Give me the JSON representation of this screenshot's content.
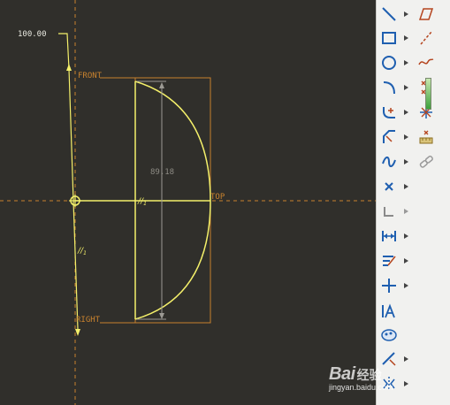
{
  "sketch": {
    "dimension_value": "100.00",
    "diameter_value": "89.18",
    "reference_labels": {
      "front": "FRONT",
      "top": "TOP",
      "right": "RIGHT"
    },
    "parallel_constraint_symbol": "//",
    "constraint_index": "1"
  },
  "toolbar": {
    "tools": [
      {
        "name": "line-tool",
        "icon": "line-icon"
      },
      {
        "name": "rectangle-tool",
        "icon": "rectangle-icon"
      },
      {
        "name": "circle-tool",
        "icon": "circle-icon"
      },
      {
        "name": "arc-tool",
        "icon": "arc-icon"
      },
      {
        "name": "fillet-tool",
        "icon": "fillet-icon"
      },
      {
        "name": "chamfer-tool",
        "icon": "chamfer-icon"
      },
      {
        "name": "spline-tool",
        "icon": "spline-icon"
      },
      {
        "name": "point-tool",
        "icon": "point-icon"
      },
      {
        "name": "coordinate-system-tool",
        "icon": "coordinate-system-icon"
      },
      {
        "name": "dimension-tool",
        "icon": "dimension-icon"
      },
      {
        "name": "modify-tool",
        "icon": "modify-icon"
      },
      {
        "name": "constraint-tool",
        "icon": "constraint-icon"
      },
      {
        "name": "text-tool",
        "icon": "text-icon"
      },
      {
        "name": "palette-tool",
        "icon": "palette-icon"
      },
      {
        "name": "trim-tool",
        "icon": "trim-icon"
      },
      {
        "name": "mirror-tool",
        "icon": "mirror-icon"
      }
    ],
    "secondary_tools": [
      {
        "name": "offset-edge-tool",
        "icon": "offset-icon"
      },
      {
        "name": "centerline-tool",
        "icon": "centerline-icon"
      },
      {
        "name": "sketched-curve-tool",
        "icon": "curve-icon"
      },
      {
        "name": "ellipse-point-tool",
        "icon": "ellipse-point-icon"
      },
      {
        "name": "cross-point-tool",
        "icon": "cross-point-icon"
      },
      {
        "name": "thickness-tool",
        "icon": "thickness-icon"
      },
      {
        "name": "link-tool",
        "icon": "link-icon"
      }
    ]
  },
  "watermark": {
    "logo": "Bai",
    "logo_cn": "经验",
    "url": "jingyan.baidu.com"
  },
  "colors": {
    "background": "#302f2b",
    "sketch_yellow": "#f4f06a",
    "reference_orange": "#c8822e",
    "toolbar_blue": "#1f5fb0",
    "toolbar_red": "#b5451f"
  }
}
